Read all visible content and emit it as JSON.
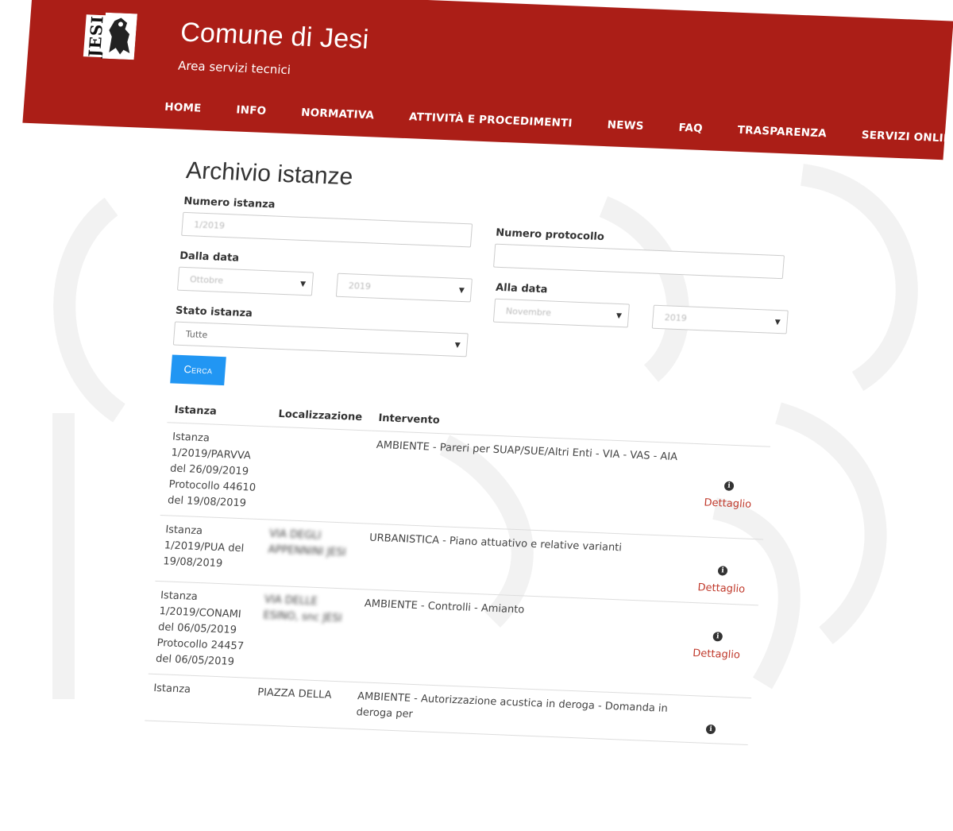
{
  "header": {
    "logo_text": "JESI",
    "site_title": "Comune di Jesi",
    "site_subtitle": "Area servizi tecnici",
    "nav": [
      "HOME",
      "INFO",
      "NORMATIVA",
      "ATTIVITÀ E PROCEDIMENTI",
      "NEWS",
      "FAQ",
      "TRASPARENZA",
      "SERVIZI ONLINE"
    ],
    "color": "#ab1e17"
  },
  "page": {
    "title": "Archivio istanze"
  },
  "form": {
    "numero_istanza_label": "Numero istanza",
    "numero_istanza_value": "1/2019",
    "numero_protocollo_label": "Numero protocollo",
    "numero_protocollo_value": "",
    "dalla_data_label": "Dalla data",
    "dalla_mese": "Ottobre",
    "dalla_anno": "2019",
    "alla_data_label": "Alla data",
    "alla_mese": "Novembre",
    "alla_anno": "2019",
    "stato_label": "Stato istanza",
    "stato_value": "Tutte",
    "cerca_label": "Cerca",
    "cerca_color": "#2196f3"
  },
  "table": {
    "headers": [
      "Istanza",
      "Localizzazione",
      "Intervento"
    ],
    "detail_label": "Dettaglio",
    "rows": [
      {
        "istanza": "Istanza 1/2019/PARVVA del 26/09/2019 Protocollo 44610 del 19/08/2019",
        "localizzazione": "",
        "intervento": "AMBIENTE - Pareri per SUAP/SUE/Altri Enti - VIA - VAS - AIA"
      },
      {
        "istanza": "Istanza 1/2019/PUA del 19/08/2019",
        "localizzazione": "VIA DEGLI APPENNINI JESI",
        "intervento": "URBANISTICA - Piano attuativo e relative varianti"
      },
      {
        "istanza": "Istanza 1/2019/CONAMI del 06/05/2019 Protocollo 24457 del 06/05/2019",
        "localizzazione": "VIA DELLE ESINO, snc JESI",
        "intervento": "AMBIENTE - Controlli - Amianto"
      },
      {
        "istanza": "Istanza",
        "localizzazione": "PIAZZA DELLA",
        "intervento": "AMBIENTE - Autorizzazione acustica in deroga - Domanda in deroga per"
      }
    ]
  }
}
